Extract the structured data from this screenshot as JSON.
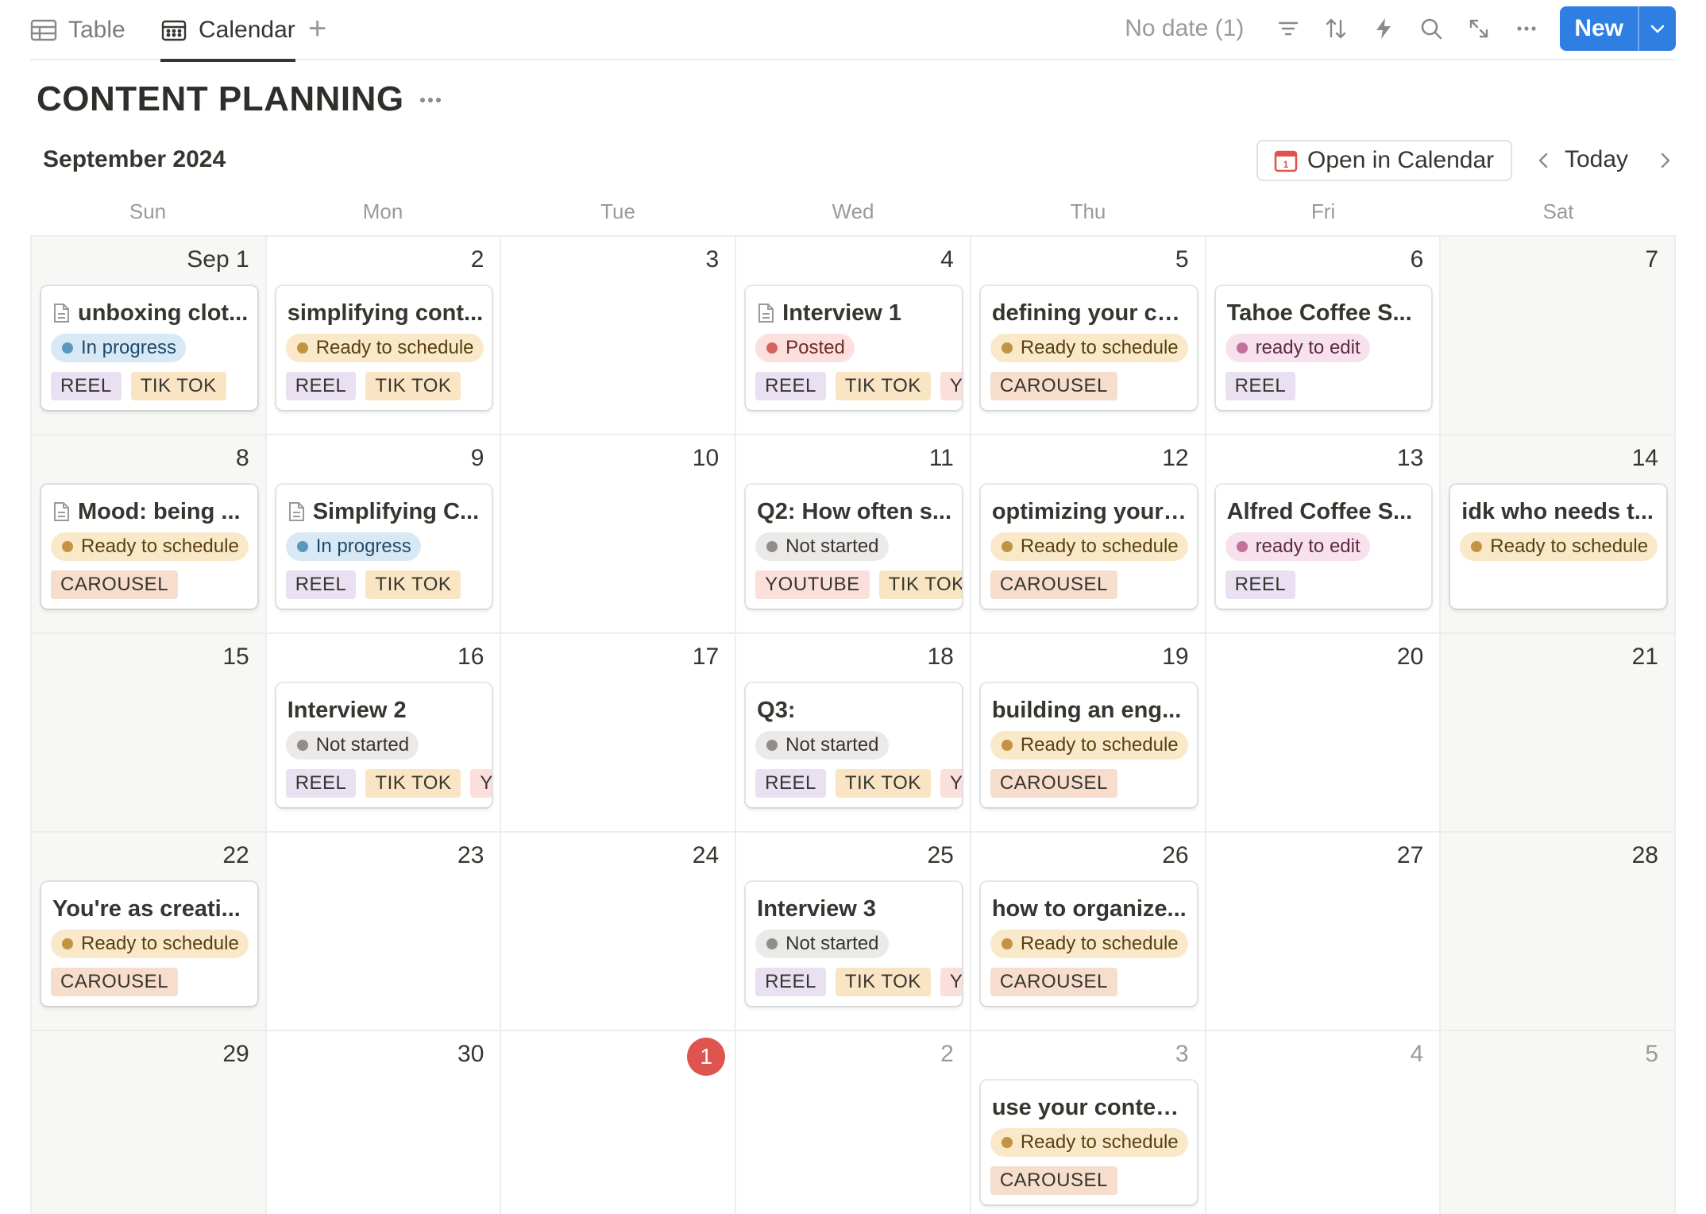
{
  "tabs": {
    "table_label": "Table",
    "calendar_label": "Calendar",
    "add_label": "+"
  },
  "toolbar": {
    "no_date_label": "No date (1)",
    "new_label": "New"
  },
  "page": {
    "title": "CONTENT PLANNING"
  },
  "calendar": {
    "month_label": "September 2024",
    "open_in_calendar_label": "Open in Calendar",
    "today_label": "Today",
    "weekdays": [
      "Sun",
      "Mon",
      "Tue",
      "Wed",
      "Thu",
      "Fri",
      "Sat"
    ],
    "days": [
      {
        "num": "Sep 1",
        "weekend": true,
        "event": {
          "title": "unboxing clot...",
          "page_icon": true,
          "status": "In progress",
          "status_style": "progress",
          "tags": [
            "REEL",
            "TIK TOK"
          ]
        }
      },
      {
        "num": "2",
        "event": {
          "title": "simplifying cont...",
          "status": "Ready to schedule",
          "status_style": "ready",
          "tags": [
            "REEL",
            "TIK TOK"
          ]
        }
      },
      {
        "num": "3"
      },
      {
        "num": "4",
        "event": {
          "title": "Interview 1",
          "page_icon": true,
          "status": "Posted",
          "status_style": "posted",
          "tags": [
            "REEL",
            "TIK TOK",
            "YOUTUBE"
          ]
        }
      },
      {
        "num": "5",
        "event": {
          "title": "defining your co...",
          "status": "Ready to schedule",
          "status_style": "ready",
          "tags": [
            "CAROUSEL"
          ]
        }
      },
      {
        "num": "6",
        "event": {
          "title": "Tahoe Coffee S...",
          "status": "ready to edit",
          "status_style": "edit",
          "tags": [
            "REEL"
          ]
        }
      },
      {
        "num": "7",
        "weekend": true
      },
      {
        "num": "8",
        "weekend": true,
        "event": {
          "title": "Mood: being ...",
          "page_icon": true,
          "status": "Ready to schedule",
          "status_style": "ready",
          "tags": [
            "CAROUSEL"
          ]
        }
      },
      {
        "num": "9",
        "event": {
          "title": "Simplifying C...",
          "page_icon": true,
          "status": "In progress",
          "status_style": "progress",
          "tags": [
            "REEL",
            "TIK TOK"
          ]
        }
      },
      {
        "num": "10"
      },
      {
        "num": "11",
        "event": {
          "title": "Q2: How often s...",
          "status": "Not started",
          "status_style": "not",
          "tags": [
            "YOUTUBE",
            "TIK TOK"
          ]
        }
      },
      {
        "num": "12",
        "event": {
          "title": "optimizing your ...",
          "status": "Ready to schedule",
          "status_style": "ready",
          "tags": [
            "CAROUSEL"
          ]
        }
      },
      {
        "num": "13",
        "event": {
          "title": "Alfred Coffee S...",
          "status": "ready to edit",
          "status_style": "edit",
          "tags": [
            "REEL"
          ]
        }
      },
      {
        "num": "14",
        "weekend": true,
        "event": {
          "title": "idk who needs t...",
          "status": "Ready to schedule",
          "status_style": "ready",
          "tags": []
        }
      },
      {
        "num": "15",
        "weekend": true
      },
      {
        "num": "16",
        "event": {
          "title": "Interview 2",
          "status": "Not started",
          "status_style": "not",
          "tags": [
            "REEL",
            "TIK TOK",
            "YOUTUBE"
          ]
        }
      },
      {
        "num": "17"
      },
      {
        "num": "18",
        "event": {
          "title": "Q3:",
          "status": "Not started",
          "status_style": "not",
          "tags": [
            "REEL",
            "TIK TOK",
            "YOUTUBE"
          ]
        }
      },
      {
        "num": "19",
        "event": {
          "title": "building an eng...",
          "status": "Ready to schedule",
          "status_style": "ready",
          "tags": [
            "CAROUSEL"
          ]
        }
      },
      {
        "num": "20"
      },
      {
        "num": "21",
        "weekend": true
      },
      {
        "num": "22",
        "weekend": true,
        "event": {
          "title": "You're as creati...",
          "status": "Ready to schedule",
          "status_style": "ready",
          "tags": [
            "CAROUSEL"
          ]
        }
      },
      {
        "num": "23"
      },
      {
        "num": "24"
      },
      {
        "num": "25",
        "event": {
          "title": "Interview 3",
          "status": "Not started",
          "status_style": "not",
          "tags": [
            "REEL",
            "TIK TOK",
            "YOUTUBE"
          ]
        }
      },
      {
        "num": "26",
        "event": {
          "title": "how to organize...",
          "status": "Ready to schedule",
          "status_style": "ready",
          "tags": [
            "CAROUSEL"
          ]
        }
      },
      {
        "num": "27"
      },
      {
        "num": "28",
        "weekend": true
      },
      {
        "num": "29",
        "weekend": true
      },
      {
        "num": "30"
      },
      {
        "num": "1",
        "today": true
      },
      {
        "num": "2",
        "dim": true
      },
      {
        "num": "3",
        "dim": true,
        "event": {
          "title": "use your conten...",
          "status": "Ready to schedule",
          "status_style": "ready",
          "tags": [
            "CAROUSEL"
          ]
        }
      },
      {
        "num": "4",
        "dim": true
      },
      {
        "num": "5",
        "dim": true,
        "weekend": true
      }
    ]
  },
  "colors": {
    "accent_blue": "#2f7fe3",
    "today_red": "#de5550",
    "status": {
      "progress": {
        "bg": "#d8e8f4",
        "dot": "#5b97bd",
        "text": "#1f4a6b"
      },
      "ready": {
        "bg": "#f9e9c9",
        "dot": "#c29343",
        "text": "#5a3f13"
      },
      "posted": {
        "bg": "#fbe0de",
        "dot": "#d4645d",
        "text": "#6e2b26"
      },
      "edit": {
        "bg": "#f6e1ec",
        "dot": "#c4709a",
        "text": "#5d2a44"
      },
      "not": {
        "bg": "#ebeae8",
        "dot": "#8f8e8a",
        "text": "#37352f"
      }
    },
    "tags": {
      "REEL": "#e9e0f1",
      "TIK TOK": "#f9e5c4",
      "YOUTUBE": "#fbdfdb",
      "CAROUSEL": "#f6ddcc"
    }
  },
  "icons": [
    "table-icon",
    "calendar-icon",
    "filter-icon",
    "sort-icon",
    "lightning-icon",
    "search-icon",
    "expand-icon",
    "more-icon",
    "chevron-down-icon",
    "chevron-left-icon",
    "chevron-right-icon",
    "page-icon"
  ]
}
